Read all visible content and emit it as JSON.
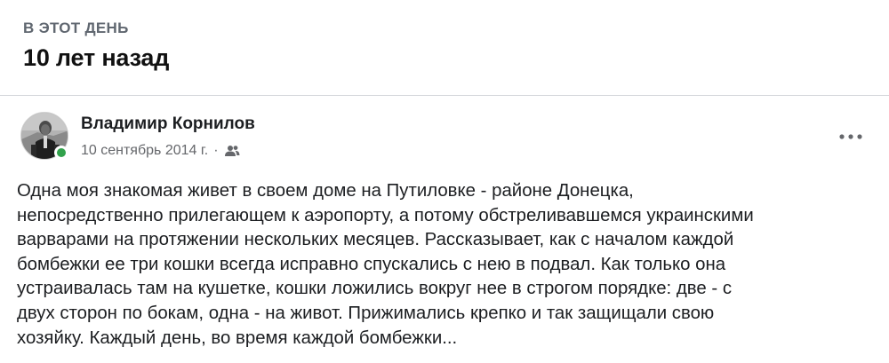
{
  "memory": {
    "label": "В ЭТОТ ДЕНЬ",
    "title": "10 лет назад"
  },
  "post": {
    "author": "Владимир Корнилов",
    "date": "10 сентябрь 2014 г.",
    "separator": "·",
    "audience_icon": "friends-icon",
    "more_icon": "more-options-icon",
    "online_status_color": "#31a24c",
    "text": "Одна моя знакомая живет в своем доме на Путиловке - районе Донецка,\nнепосредственно прилегающем к аэропорту, а потому обстреливавшемся украинскими\nварварами на протяжении нескольких месяцев. Рассказывает, как с началом каждой\nбомбежки ее три кошки всегда исправно спускались с нею в подвал. Как только она\nустраивалась там на кушетке, кошки ложились вокруг нее в строгом порядке: две - с\nдвух сторон по бокам, одна - на живот. Прижимались крепко и так защищали свою\nхозяйку. Каждый день, во время каждой бомбежки..."
  }
}
